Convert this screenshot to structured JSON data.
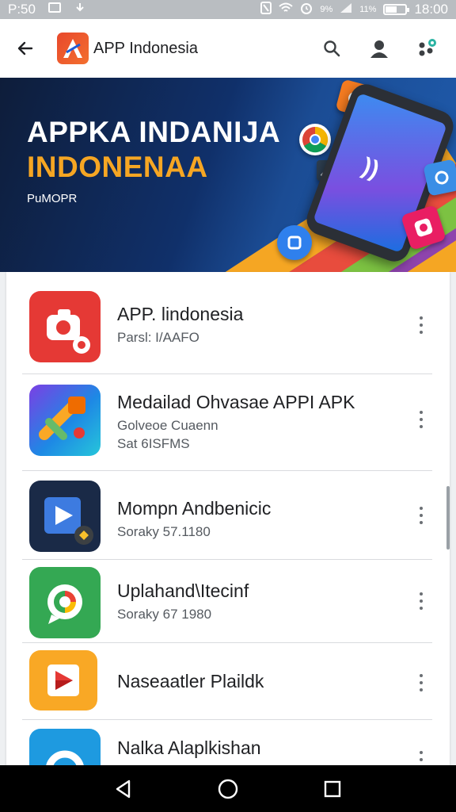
{
  "status_bar": {
    "time_left": "P:50",
    "battery_text": "11%",
    "signal_text": "9%",
    "battery_level": 0.55,
    "time_right": "18:00"
  },
  "app_bar": {
    "title": "APP Indonesia",
    "icons": [
      "back-arrow-icon",
      "app-logo-icon",
      "search-icon",
      "account-icon",
      "apps-settings-icon"
    ]
  },
  "banner": {
    "title_line1": "APPKA INDANIJA",
    "title_line2": "INDONENAA",
    "subtitle": "PuMOPR"
  },
  "list": {
    "items": [
      {
        "name": "APP. lindonesia",
        "sub": "Parsl: I/AAFO",
        "sub2": "",
        "icon": "camera-icon"
      },
      {
        "name": "Medailad Ohvasae APPI APK",
        "sub": "Golveoe Cuaenn",
        "sub2": "Sat 6ISFMS",
        "icon": "puzzle-icon"
      },
      {
        "name": "Mompn Andbenicic",
        "sub": "Soraky 57.1180",
        "sub2": "",
        "icon": "play-icon"
      },
      {
        "name": "Uplahand\\Itecinf",
        "sub": "Soraky 67 1980",
        "sub2": "",
        "icon": "chat-icon"
      },
      {
        "name": "Naseaatler Plaildk",
        "sub": "",
        "sub2": "",
        "icon": "play-store-icon"
      },
      {
        "name": "Nalka Alaplkishan",
        "sub": "",
        "sub2": "",
        "icon": "search-app-icon"
      }
    ]
  },
  "nav_bar": {
    "icons": [
      "back-triangle-icon",
      "home-circle-icon",
      "recents-square-icon"
    ]
  },
  "colors": {
    "accent_orange": "#f6a623",
    "banner_navy": "#10306a",
    "row1_icon": "#e53935",
    "row3_icon": "#1a2a47",
    "row4_icon": "#34a853",
    "row5_icon": "#f9a825",
    "row6_icon": "#1e9ae0"
  }
}
